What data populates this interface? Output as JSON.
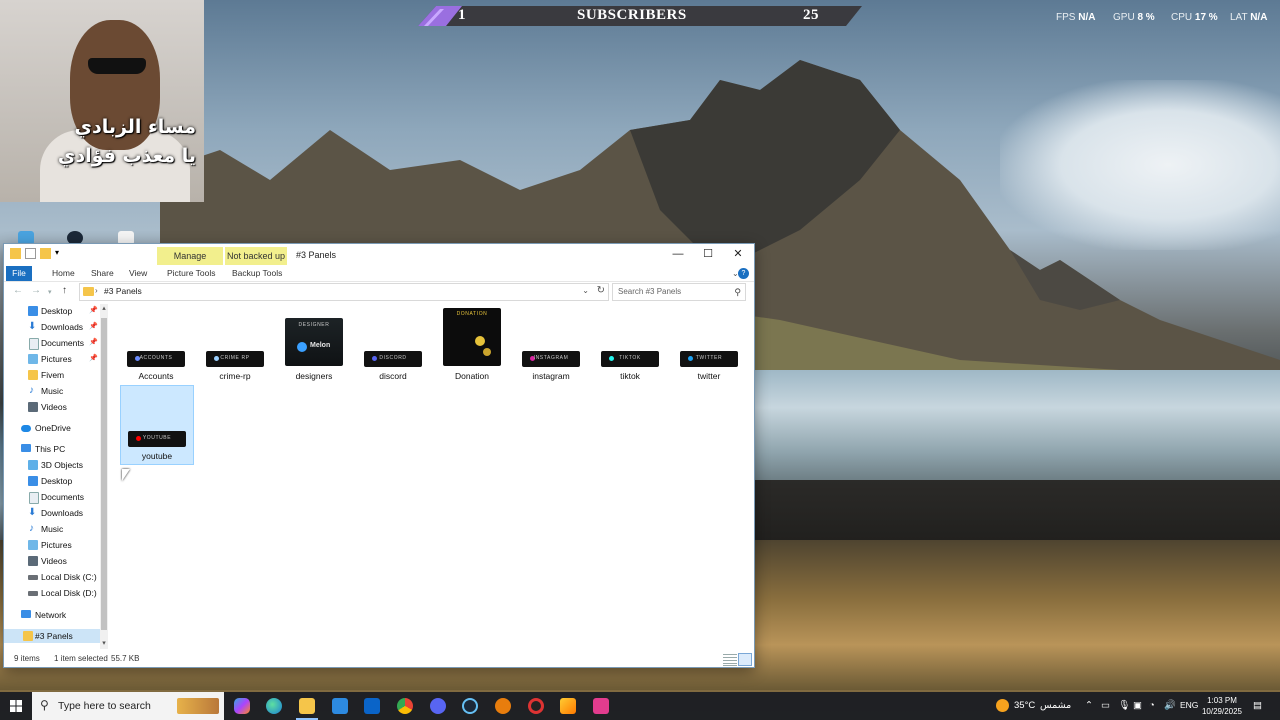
{
  "overlay": {
    "subscribers_current": "1",
    "subscribers_label": "SUBSCRIBERS",
    "subscribers_goal": "25",
    "fps_label": "FPS",
    "fps_value": "N/A",
    "gpu_label": "GPU",
    "gpu_value": "8 %",
    "cpu_label": "CPU",
    "cpu_value": "17 %",
    "lat_label": "LAT",
    "lat_value": "N/A"
  },
  "webcam": {
    "caption_line1": "مساء الزبادي",
    "caption_line2": "يا معذب فؤادي"
  },
  "explorer": {
    "title": "#3 Panels",
    "contextual_tabs": [
      "Manage",
      "Not backed up"
    ],
    "ribbon_tabs": [
      "File",
      "Home",
      "Share",
      "View",
      "Picture Tools",
      "Backup Tools"
    ],
    "address_crumb": "#3 Panels",
    "search_placeholder": "Search #3 Panels",
    "nav": {
      "quick_access": [
        {
          "label": "Desktop",
          "icon": "desktop-icon",
          "pinned": true
        },
        {
          "label": "Downloads",
          "icon": "download-arrow-icon",
          "pinned": true
        },
        {
          "label": "Documents",
          "icon": "document-icon",
          "pinned": true
        },
        {
          "label": "Pictures",
          "icon": "pictures-icon",
          "pinned": true
        },
        {
          "label": "Fivem",
          "icon": "folder-icon",
          "pinned": false
        },
        {
          "label": "Music",
          "icon": "music-note-icon",
          "pinned": false
        },
        {
          "label": "Videos",
          "icon": "video-icon",
          "pinned": false
        }
      ],
      "onedrive": "OneDrive",
      "this_pc": "This PC",
      "this_pc_items": [
        {
          "label": "3D Objects",
          "icon": "cube-icon"
        },
        {
          "label": "Desktop",
          "icon": "desktop-icon"
        },
        {
          "label": "Documents",
          "icon": "document-icon"
        },
        {
          "label": "Downloads",
          "icon": "download-arrow-icon"
        },
        {
          "label": "Music",
          "icon": "music-note-icon"
        },
        {
          "label": "Pictures",
          "icon": "pictures-icon"
        },
        {
          "label": "Videos",
          "icon": "video-icon"
        },
        {
          "label": "Local Disk (C:)",
          "icon": "drive-icon"
        },
        {
          "label": "Local Disk (D:)",
          "icon": "drive-icon"
        }
      ],
      "network": "Network",
      "selected_folder": "#3 Panels"
    },
    "files": [
      {
        "name": "Accounts",
        "thumb_text": "Accounts",
        "accent": "#6b8cff"
      },
      {
        "name": "crime-rp",
        "thumb_text": "Crime RP",
        "accent": "#9bd0ff"
      },
      {
        "name": "designers",
        "thumb_text": "Designer",
        "accent": "#3aa0ff"
      },
      {
        "name": "discord",
        "thumb_text": "Discord",
        "accent": "#5865f2"
      },
      {
        "name": "Donation",
        "thumb_text": "Donation",
        "accent": "#e6c23a"
      },
      {
        "name": "instagram",
        "thumb_text": "Instagram",
        "accent": "#d6249f"
      },
      {
        "name": "tiktok",
        "thumb_text": "Tiktok",
        "accent": "#25f4ee"
      },
      {
        "name": "twitter",
        "thumb_text": "Twitter",
        "accent": "#1da1f2"
      },
      {
        "name": "youtube",
        "thumb_text": "Youtube",
        "accent": "#ff0000"
      }
    ],
    "designer_thumb_brand": "Melon",
    "status_items": "9 items",
    "status_selected": "1 item selected",
    "status_size": "55.7 KB"
  },
  "taskbar": {
    "search_placeholder": "Type here to search",
    "weather_temp": "35°C",
    "weather_desc": "مشمس",
    "language": "ENG",
    "time": "1:03 PM",
    "date": "10/29/2025"
  }
}
